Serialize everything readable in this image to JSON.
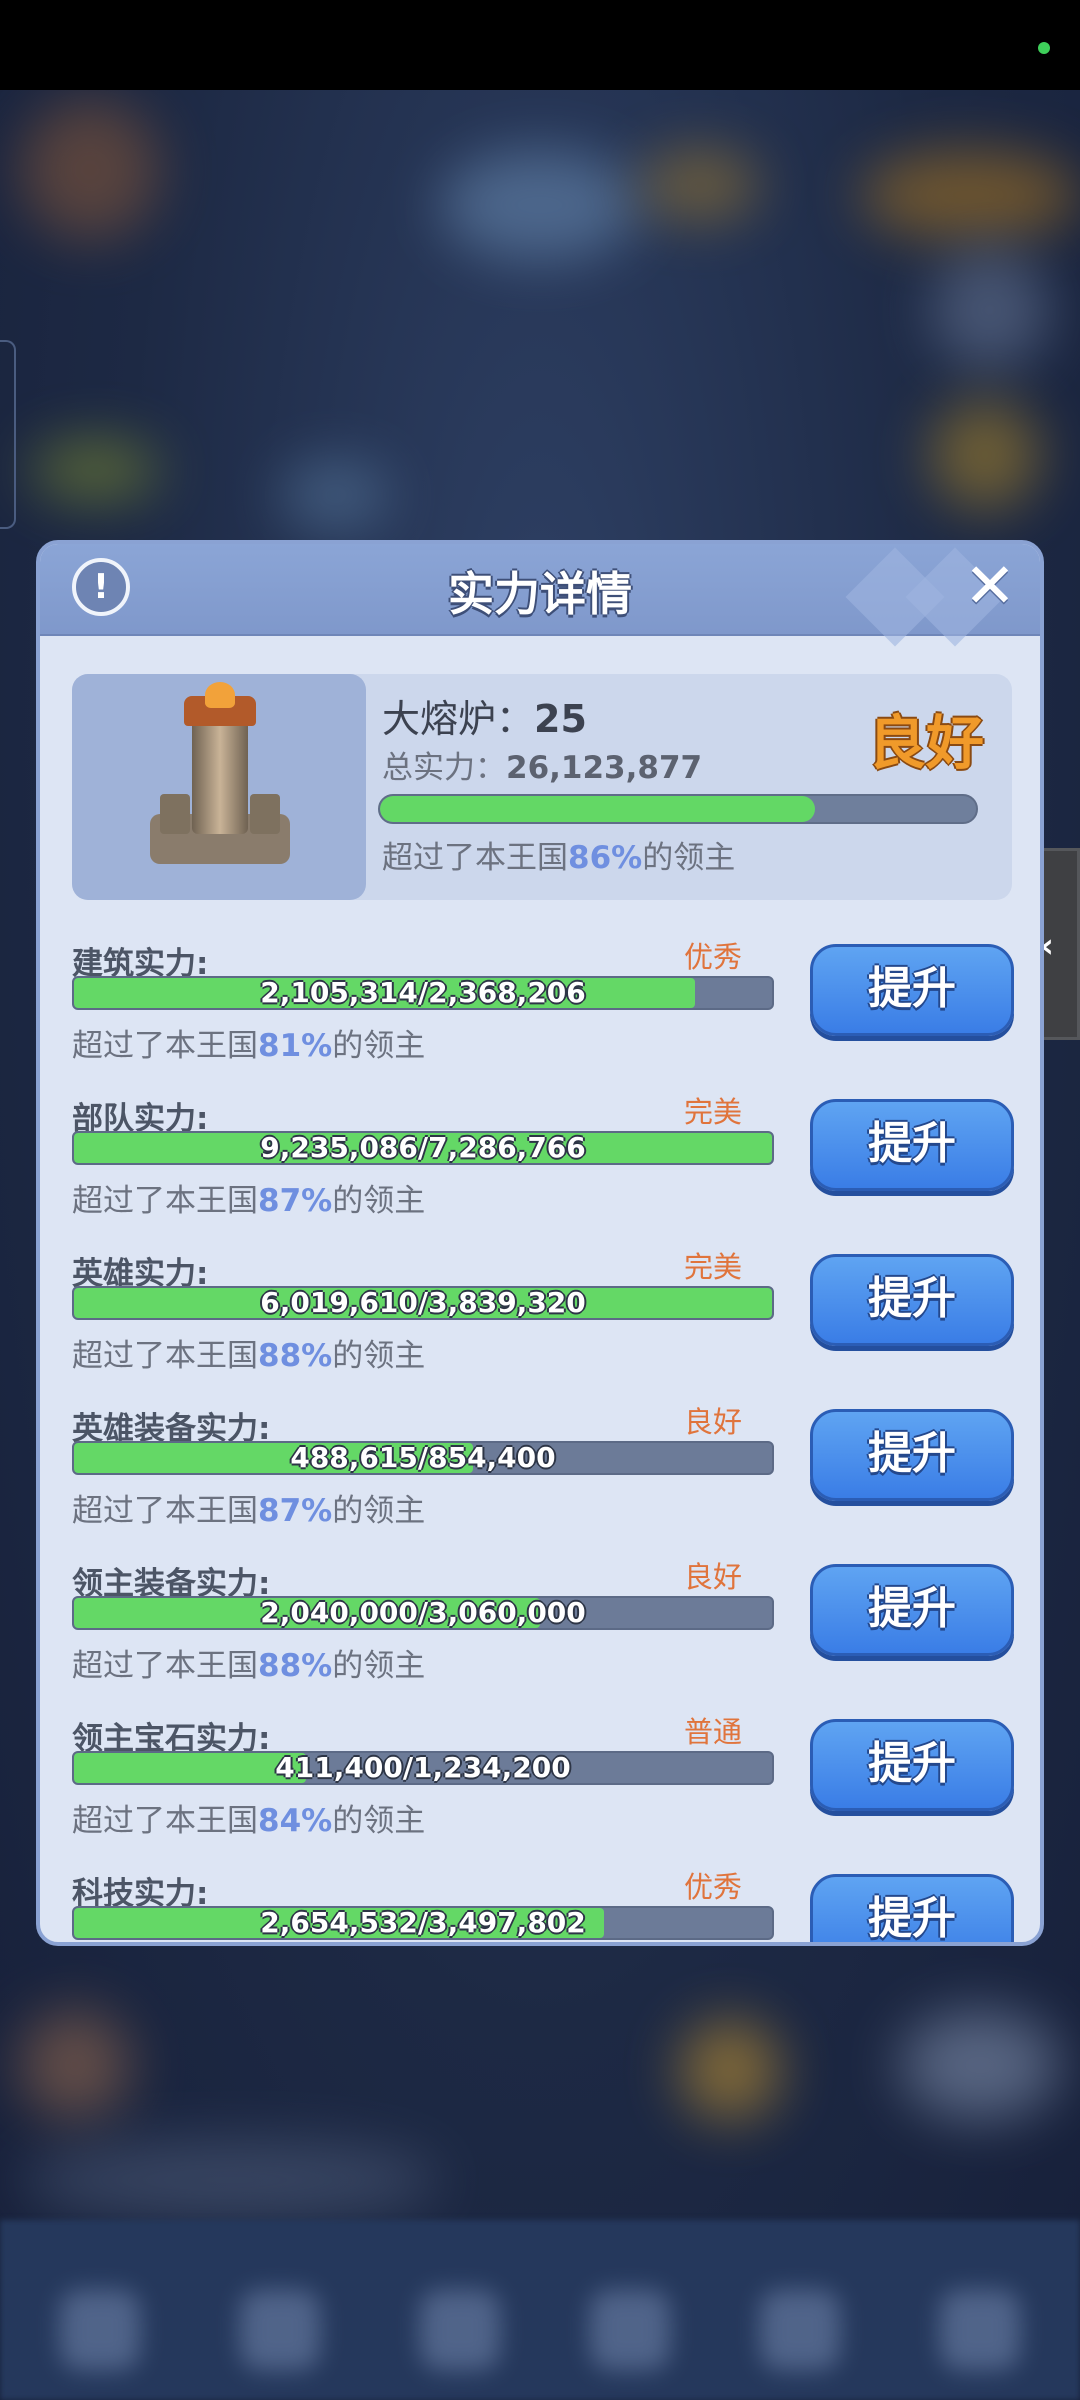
{
  "dialog": {
    "title": "实力详情",
    "info_icon": "!",
    "close_icon": "✕"
  },
  "summary": {
    "furnace_label": "大熔炉：",
    "furnace_level": "25",
    "total_label": "总实力：",
    "total_value": "26,123,877",
    "rating": "良好",
    "progress": 0.73,
    "note_prefix": "超过了本王国",
    "note_pct": "86%",
    "note_suffix": "的领主"
  },
  "categories": [
    {
      "label": "建筑实力:",
      "rating": "优秀",
      "value_text": "2,105,314/2,368,206",
      "progress": 0.889,
      "pct": "81%",
      "button": "提升"
    },
    {
      "label": "部队实力:",
      "rating": "完美",
      "value_text": "9,235,086/7,286,766",
      "progress": 1.0,
      "pct": "87%",
      "button": "提升"
    },
    {
      "label": "英雄实力:",
      "rating": "完美",
      "value_text": "6,019,610/3,839,320",
      "progress": 1.0,
      "pct": "88%",
      "button": "提升"
    },
    {
      "label": "英雄装备实力:",
      "rating": "良好",
      "value_text": "488,615/854,400",
      "progress": 0.572,
      "pct": "87%",
      "button": "提升"
    },
    {
      "label": "领主装备实力:",
      "rating": "良好",
      "value_text": "2,040,000/3,060,000",
      "progress": 0.667,
      "pct": "88%",
      "button": "提升"
    },
    {
      "label": "领主宝石实力:",
      "rating": "普通",
      "value_text": "411,400/1,234,200",
      "progress": 0.333,
      "pct": "84%",
      "button": "提升"
    },
    {
      "label": "科技实力:",
      "rating": "优秀",
      "value_text": "2,654,532/3,497,802",
      "progress": 0.759,
      "pct": "",
      "button": "提升"
    }
  ],
  "note_prefix": "超过了本王国",
  "note_suffix": "的领主",
  "side_button_icon": "‹"
}
